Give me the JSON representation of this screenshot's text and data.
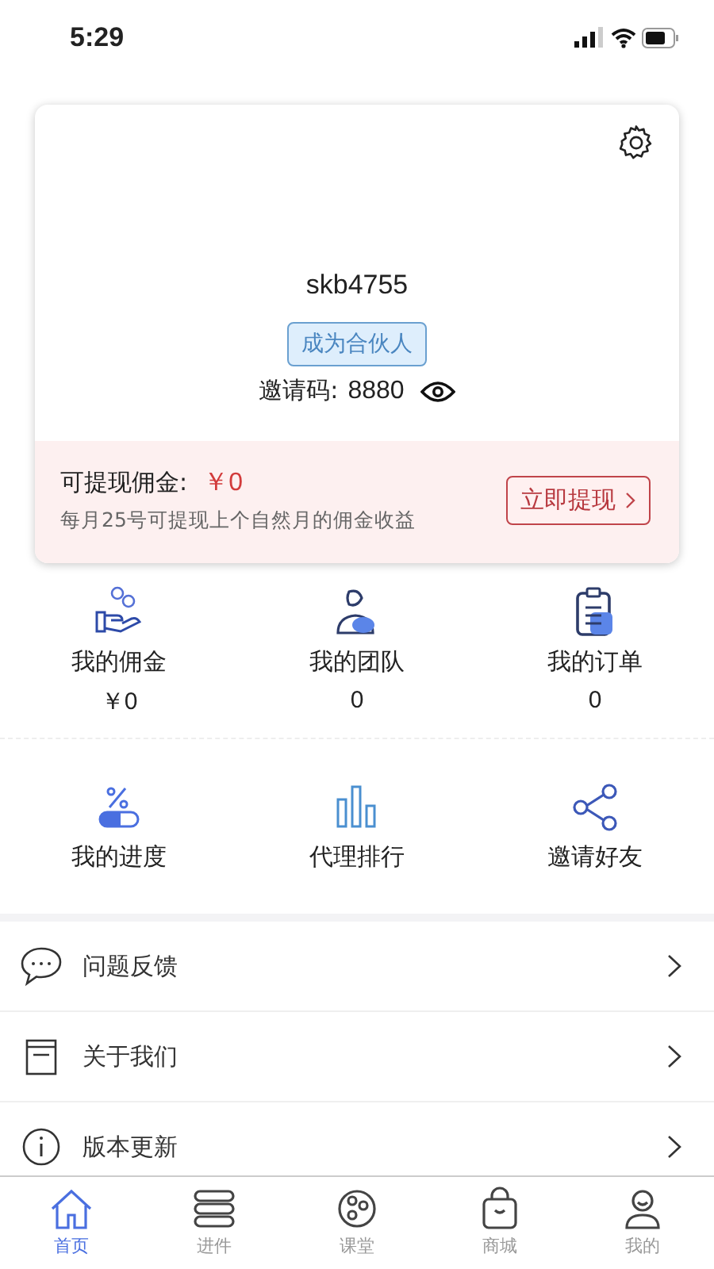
{
  "status_bar": {
    "time": "5:29"
  },
  "profile": {
    "username": "skb4755",
    "partner_button": "成为合伙人",
    "invite_label": "邀请码:",
    "invite_code": "8880"
  },
  "withdraw": {
    "label": "可提现佣金:",
    "amount": "￥0",
    "note": "每月25号可提现上个自然月的佣金收益",
    "button": "立即提现"
  },
  "stats": [
    {
      "kind": "commission",
      "label": "我的佣金",
      "value": "￥0"
    },
    {
      "kind": "team",
      "label": "我的团队",
      "value": "0"
    },
    {
      "kind": "orders",
      "label": "我的订单",
      "value": "0"
    }
  ],
  "shortcuts": [
    {
      "kind": "progress",
      "label": "我的进度"
    },
    {
      "kind": "ranking",
      "label": "代理排行"
    },
    {
      "kind": "invite",
      "label": "邀请好友"
    }
  ],
  "menu": [
    {
      "kind": "feedback",
      "label": "问题反馈"
    },
    {
      "kind": "about",
      "label": "关于我们"
    },
    {
      "kind": "info",
      "label": "版本更新"
    }
  ],
  "tab_bar": [
    {
      "kind": "home",
      "label": "首页",
      "selected": true
    },
    {
      "kind": "list",
      "label": "进件",
      "selected": false
    },
    {
      "kind": "planet",
      "label": "课堂",
      "selected": false
    },
    {
      "kind": "bag",
      "label": "商城",
      "selected": false
    },
    {
      "kind": "person",
      "label": "我的",
      "selected": false
    }
  ]
}
